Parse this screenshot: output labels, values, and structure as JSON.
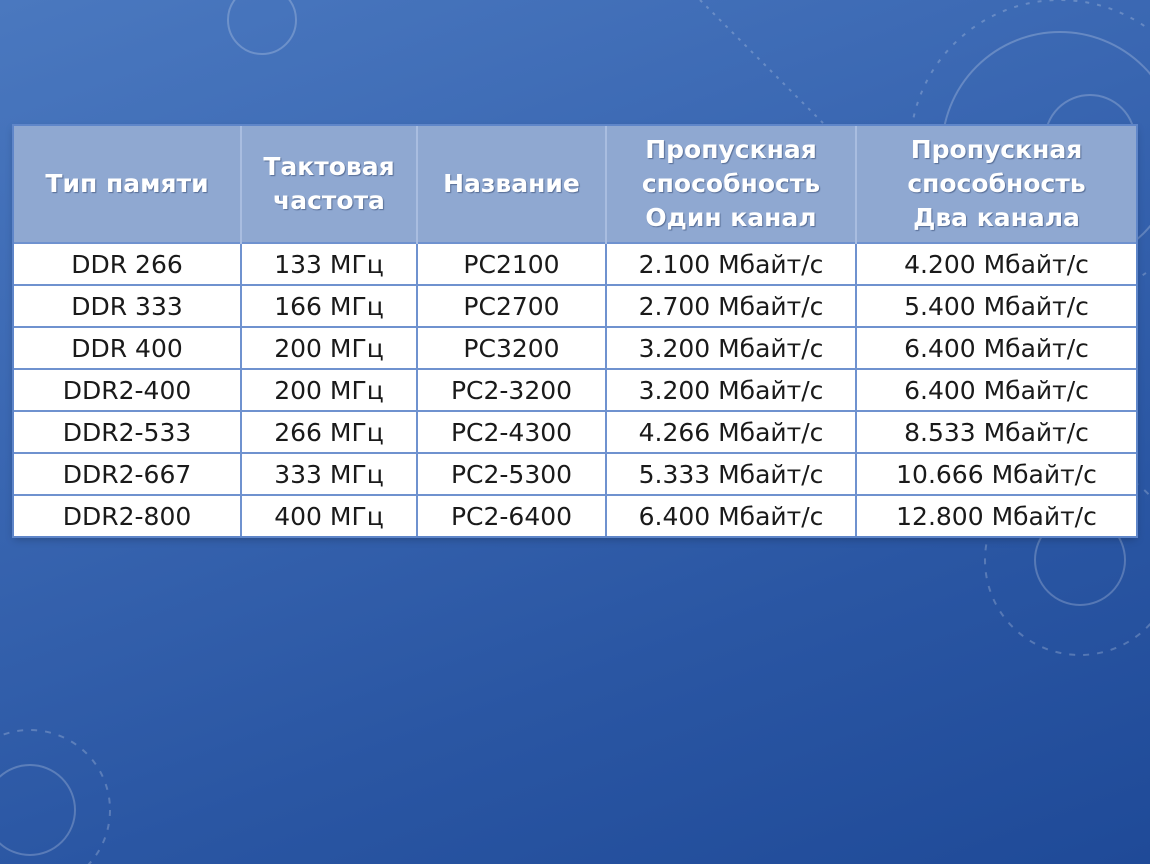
{
  "table": {
    "headers": [
      [
        "Тип памяти"
      ],
      [
        "Тактовая",
        "частота"
      ],
      [
        "Название"
      ],
      [
        "Пропускная",
        "способность",
        "Один канал"
      ],
      [
        "Пропускная",
        "способность",
        "Два канала"
      ]
    ],
    "rows": [
      [
        "DDR 266",
        "133 МГц",
        "PC2100",
        "2.100 Мбайт/с",
        "4.200 Мбайт/с"
      ],
      [
        "DDR 333",
        "166 МГц",
        "PC2700",
        "2.700 Мбайт/с",
        "5.400 Мбайт/с"
      ],
      [
        "DDR 400",
        "200 МГц",
        "PC3200",
        "3.200 Мбайт/с",
        "6.400 Мбайт/с"
      ],
      [
        "DDR2-400",
        "200 МГц",
        "PC2-3200",
        "3.200 Мбайт/с",
        "6.400 Мбайт/с"
      ],
      [
        "DDR2-533",
        "266 МГц",
        "PC2-4300",
        "4.266 Мбайт/с",
        "8.533 Мбайт/с"
      ],
      [
        "DDR2-667",
        "333 МГц",
        "PC2-5300",
        "5.333 Мбайт/с",
        "10.666 Мбайт/с"
      ],
      [
        "DDR2-800",
        "400 МГц",
        "PC2-6400",
        "6.400 Мбайт/с",
        "12.800 Мбайт/с"
      ]
    ]
  },
  "colors": {
    "header_bg": "#8fa8d1",
    "grid_line": "#6f92cf",
    "slide_bg": "#2f5ca8"
  }
}
